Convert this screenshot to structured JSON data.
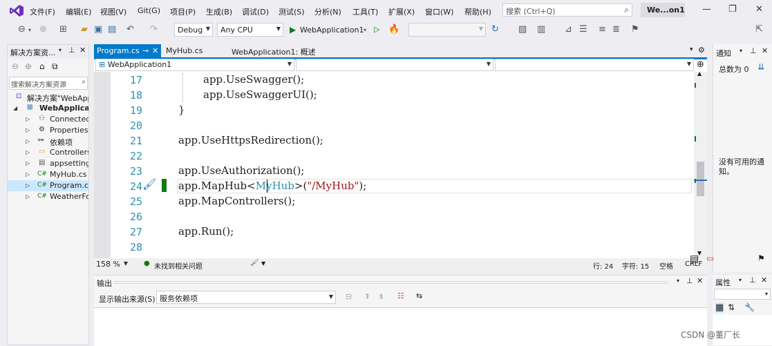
{
  "menu": {
    "items": [
      "文件(F)",
      "编辑(E)",
      "视图(V)",
      "Git(G)",
      "项目(P)",
      "生成(B)",
      "调试(D)",
      "测试(S)",
      "分析(N)",
      "工具(T)",
      "扩展(X)",
      "窗口(W)",
      "帮助(H)"
    ],
    "search_placeholder": "搜索 (Ctrl+Q)",
    "window_title": "We...on1"
  },
  "toolbar": {
    "config": "Debug",
    "platform": "Any CPU",
    "run_target": "WebApplication1"
  },
  "solution_explorer": {
    "title": "解决方案资...",
    "search_placeholder": "搜索解决方案资源",
    "items": [
      {
        "label": "解决方案\"WebApp",
        "icon": "solution-icon"
      },
      {
        "label": "WebApplicati",
        "icon": "project-icon"
      },
      {
        "label": "Connected",
        "icon": "connected-services-icon"
      },
      {
        "label": "Properties",
        "icon": "properties-icon"
      },
      {
        "label": "依赖项",
        "icon": "dependencies-icon"
      },
      {
        "label": "Controllers",
        "icon": "folder-icon"
      },
      {
        "label": "appsettings",
        "icon": "json-file-icon"
      },
      {
        "label": "MyHub.cs",
        "icon": "csharp-file-icon"
      },
      {
        "label": "Program.cs",
        "icon": "csharp-file-icon"
      },
      {
        "label": "WeatherFo",
        "icon": "csharp-file-icon"
      }
    ]
  },
  "editor": {
    "tabs": [
      {
        "label": "Program.cs",
        "pin": "⊸",
        "active": true
      },
      {
        "label": "MyHub.cs",
        "active": false
      },
      {
        "label": "WebApplication1: 概述",
        "active": false
      }
    ],
    "nav_project": "WebApplication1",
    "line_numbers": [
      "17",
      "18",
      "19",
      "20",
      "21",
      "22",
      "23",
      "24",
      "25",
      "26",
      "27",
      "28"
    ],
    "lines": [
      {
        "a": "app.UseSwagger();"
      },
      {
        "a": "app.UseSwaggerUI();"
      },
      {
        "a": "}"
      },
      {
        "a": ""
      },
      {
        "a": "app.UseHttpsRedirection();"
      },
      {
        "a": ""
      },
      {
        "a": "app.UseAuthorization();"
      },
      {
        "a": "app.MapHub<",
        "cls": "MyHub",
        "b": ">(",
        "str": "\"/MyHub\"",
        "c": ");"
      },
      {
        "a": "app.MapControllers();"
      },
      {
        "a": ""
      },
      {
        "a": "app.Run();"
      },
      {
        "a": ""
      }
    ]
  },
  "status": {
    "zoom": "158 %",
    "issues": "未找到相关问题",
    "line": "行: 24",
    "char": "字符: 15",
    "spaces": "空格",
    "eol": "CRLF"
  },
  "notifications": {
    "title": "通知",
    "count": "总数为 0",
    "empty": "没有可用的通知。"
  },
  "output": {
    "title": "输出",
    "source_label": "显示输出来源(S):",
    "source_value": "服务依赖项"
  },
  "properties": {
    "title": "属性"
  },
  "watermark": "CSDN @董厂长",
  "colors": {
    "accent": "#007acc",
    "active_tab": "#007acc",
    "line_number": "#2b91af",
    "class_name": "#2b91af",
    "string": "#a31515",
    "changed_marker": "#107c10"
  }
}
